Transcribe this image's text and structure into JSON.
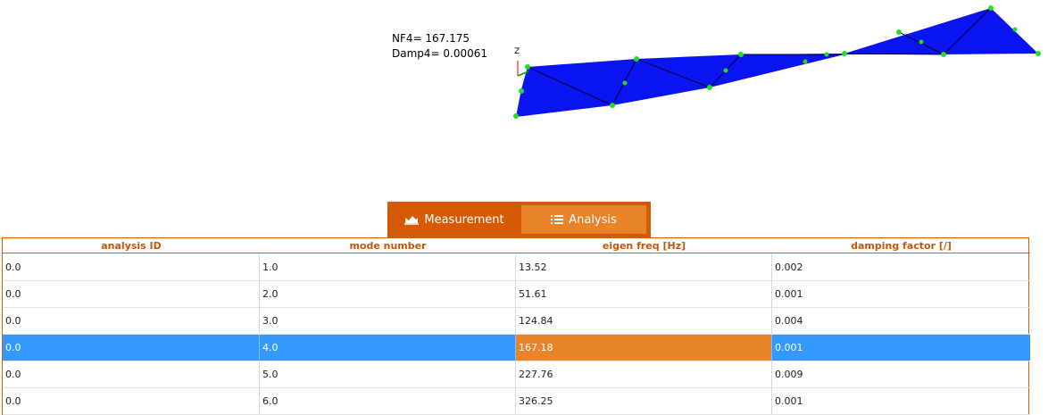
{
  "viewport": {
    "mode_freq_text": "NF4= 167.175",
    "mode_damp_text": "Damp4= 0.00061",
    "axis_z": "Z",
    "mesh_color": "#0a14f0",
    "node_color": "#22dd22"
  },
  "tabs": {
    "measurement_label": "Measurement",
    "analysis_label": "Analysis",
    "active": "analysis",
    "bar_color": "#d65a06"
  },
  "table": {
    "headers": [
      "analysis ID",
      "mode number",
      "eigen freq [Hz]",
      "damping factor [/]"
    ],
    "rows": [
      [
        "0.0",
        "1.0",
        "13.52",
        "0.002"
      ],
      [
        "0.0",
        "2.0",
        "51.61",
        "0.001"
      ],
      [
        "0.0",
        "3.0",
        "124.84",
        "0.004"
      ],
      [
        "0.0",
        "4.0",
        "167.18",
        "0.001"
      ],
      [
        "0.0",
        "5.0",
        "227.76",
        "0.009"
      ],
      [
        "0.0",
        "6.0",
        "326.25",
        "0.001"
      ]
    ],
    "selected_row": 3,
    "selection_color": "#3399ff",
    "highlight_color": "#e8832a"
  }
}
